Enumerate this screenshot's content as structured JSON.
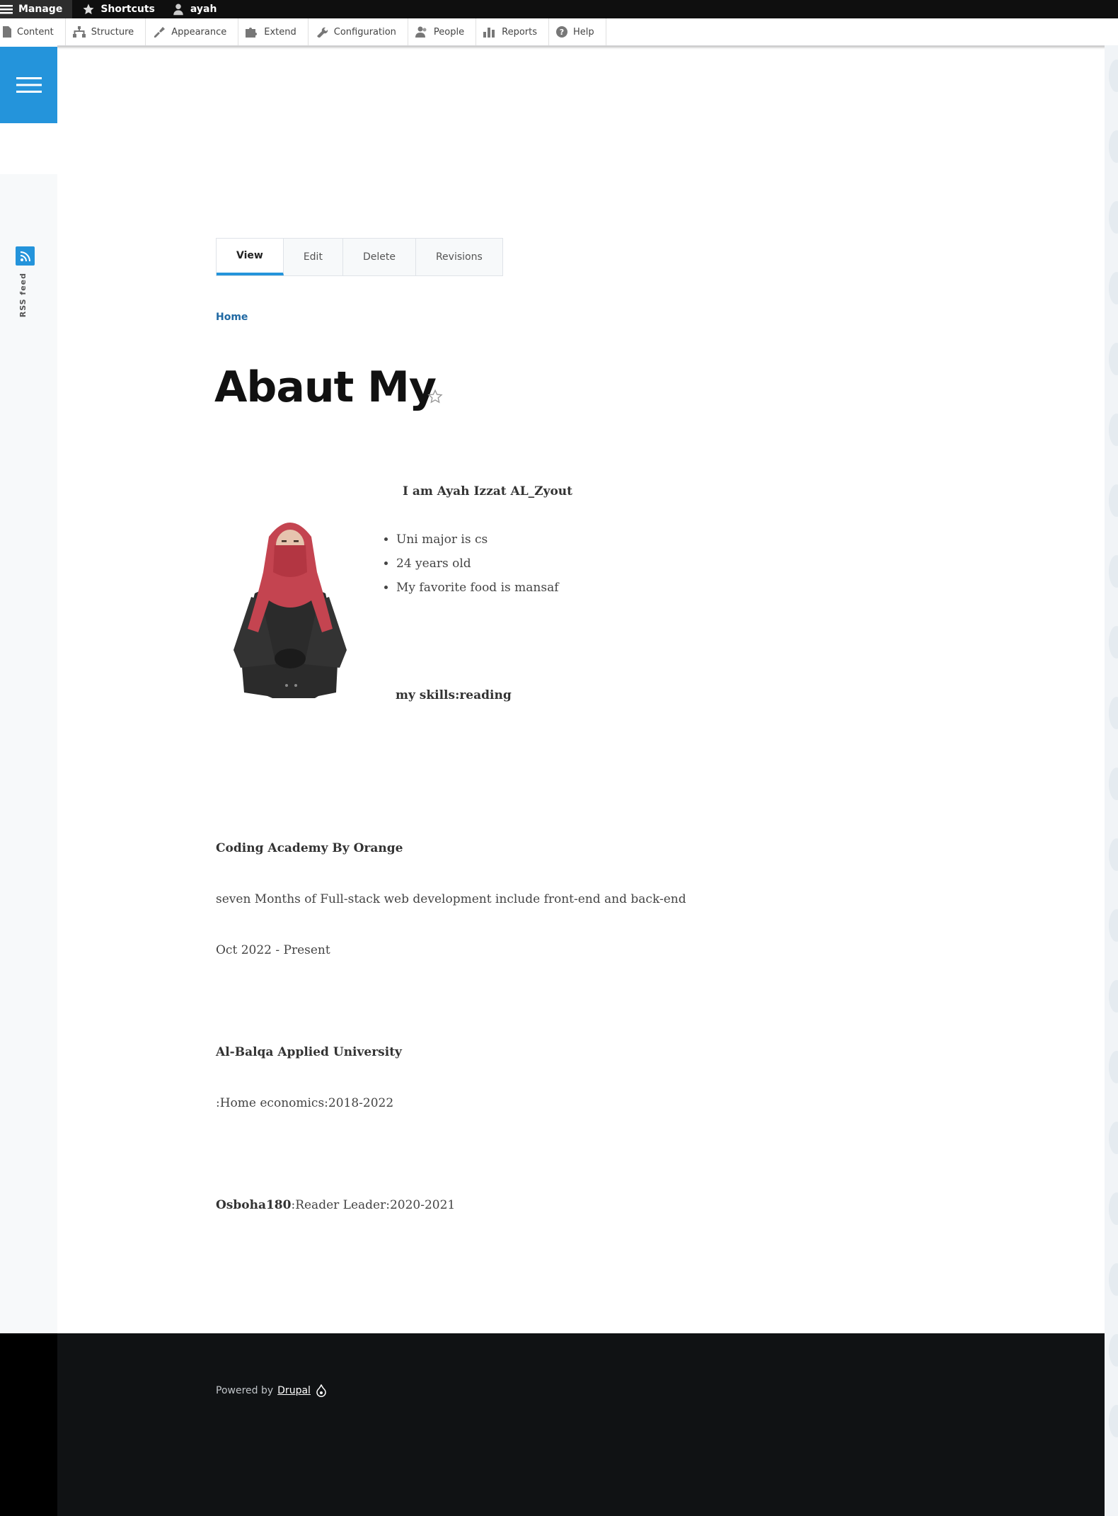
{
  "toolbar": {
    "manage": "Manage",
    "shortcuts": "Shortcuts",
    "user": "ayah"
  },
  "tray": [
    {
      "label": "Content",
      "icon": "file-icon"
    },
    {
      "label": "Structure",
      "icon": "sitemap-icon"
    },
    {
      "label": "Appearance",
      "icon": "paintbrush-icon"
    },
    {
      "label": "Extend",
      "icon": "puzzle-icon"
    },
    {
      "label": "Configuration",
      "icon": "wrench-icon"
    },
    {
      "label": "People",
      "icon": "people-icon"
    },
    {
      "label": "Reports",
      "icon": "bar-chart-icon"
    },
    {
      "label": "Help",
      "icon": "help-icon"
    }
  ],
  "sidebar": {
    "rss_label": "RSS feed"
  },
  "tabs": [
    "View",
    "Edit",
    "Delete",
    "Revisions"
  ],
  "breadcrumb": "Home",
  "page": {
    "title": "Abaut My",
    "intro_heading": "I am Ayah Izzat AL_Zyout",
    "facts": [
      "Uni major is cs",
      "24 years old",
      "My favorite food is mansaf"
    ],
    "skills": "my skills:reading",
    "experience_title": "Coding Academy By Orange",
    "experience_desc": "seven Months of Full-stack web development include front-end and back-end",
    "experience_date": "Oct 2022 - Present",
    "education_title": "Al-Balqa Applied University",
    "education_desc": ":Home economics:2018-2022",
    "volunteer_org": "Osboha180",
    "volunteer_desc": ":Reader Leader:2020-2021"
  },
  "footer": {
    "powered_by": "Powered by",
    "link": "Drupal"
  },
  "colors": {
    "accent": "#2494db",
    "link": "#2069a3",
    "toolbar_bg": "#0f0f0f",
    "footer_bg": "#101214"
  }
}
